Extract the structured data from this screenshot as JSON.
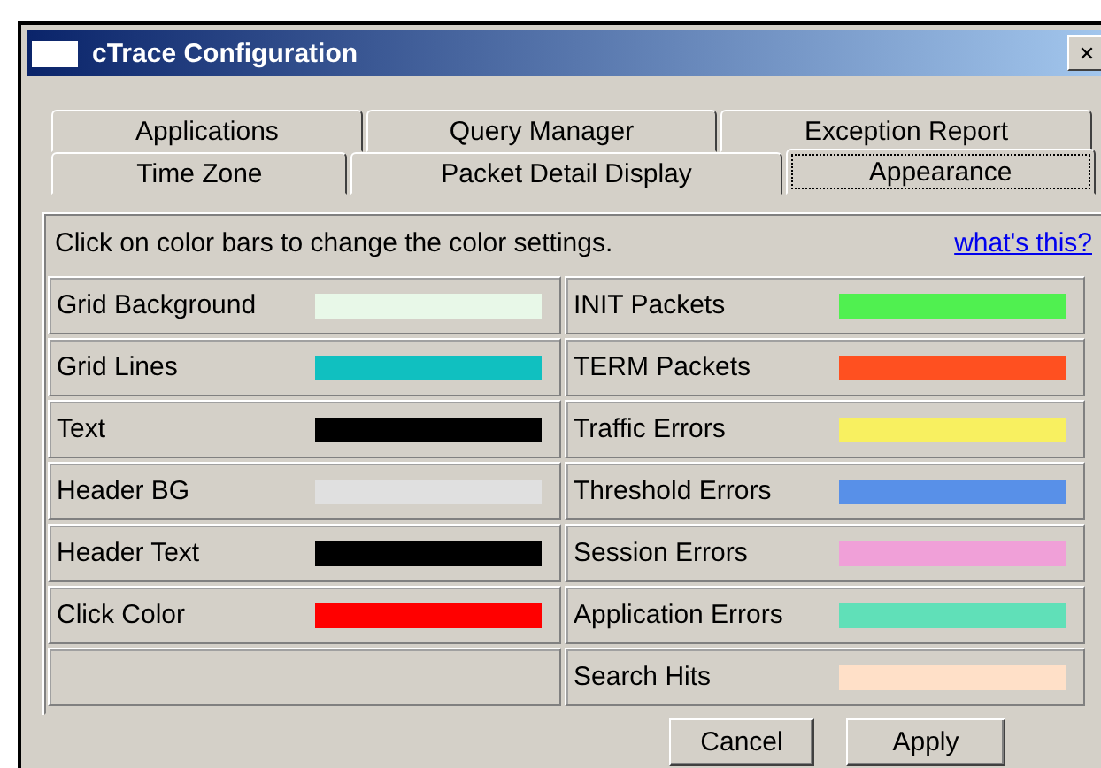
{
  "window": {
    "title": "cTrace Configuration"
  },
  "tab_rows": [
    [
      {
        "label": "Applications",
        "selected": false
      },
      {
        "label": "Query Manager",
        "selected": false
      },
      {
        "label": "Exception Report",
        "selected": false
      }
    ],
    [
      {
        "label": "Time Zone",
        "selected": false
      },
      {
        "label": "Packet Detail Display",
        "selected": false
      },
      {
        "label": "Appearance",
        "selected": true
      }
    ]
  ],
  "instructions": "Click on color bars to change the color settings.",
  "help_link": "what's this?",
  "color_settings": {
    "left": [
      {
        "label": "Grid Background",
        "color": "#e8f8e8"
      },
      {
        "label": "Grid Lines",
        "color": "#10c0c0"
      },
      {
        "label": "Text",
        "color": "#000000"
      },
      {
        "label": "Header BG",
        "color": "#e0e0e0"
      },
      {
        "label": "Header Text",
        "color": "#000000"
      },
      {
        "label": "Click Color",
        "color": "#ff0000"
      }
    ],
    "right": [
      {
        "label": "INIT Packets",
        "color": "#50f050"
      },
      {
        "label": "TERM Packets",
        "color": "#ff5020"
      },
      {
        "label": "Traffic Errors",
        "color": "#f8f060"
      },
      {
        "label": "Threshold Errors",
        "color": "#5890e8"
      },
      {
        "label": "Session Errors",
        "color": "#f0a0d8"
      },
      {
        "label": "Application Errors",
        "color": "#60e0b8"
      },
      {
        "label": "Search Hits",
        "color": "#ffe0c8"
      }
    ]
  },
  "buttons": [
    "Cancel",
    "Apply"
  ]
}
